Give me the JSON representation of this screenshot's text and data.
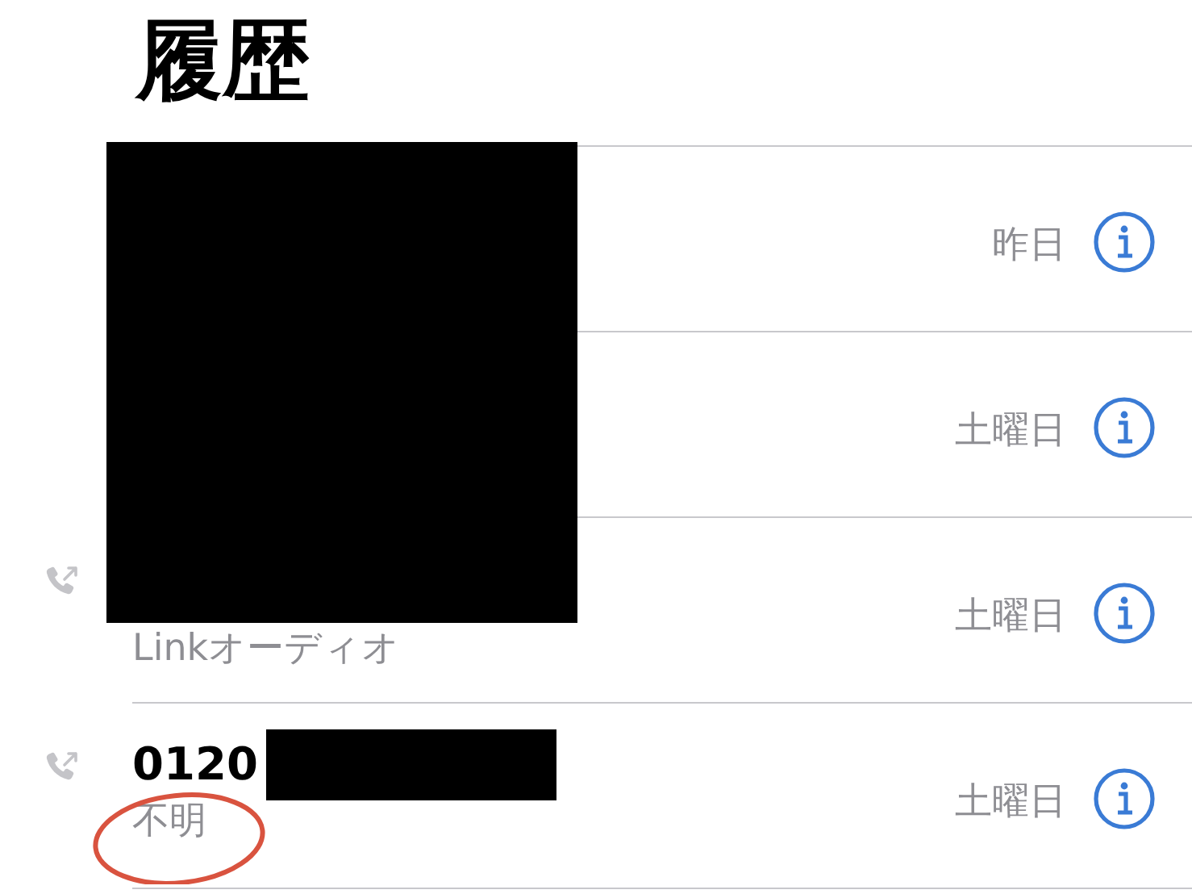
{
  "title": "履歴",
  "calls": [
    {
      "outgoing": false,
      "date": "昨日",
      "circled": false
    },
    {
      "outgoing": false,
      "date": "土曜日",
      "circled": false
    },
    {
      "outgoing": true,
      "subtitle": "Linkオーディオ",
      "date": "土曜日",
      "circled": false
    },
    {
      "outgoing": true,
      "name": "0120",
      "subtitle": "不明",
      "date": "土曜日",
      "circled": true
    }
  ]
}
